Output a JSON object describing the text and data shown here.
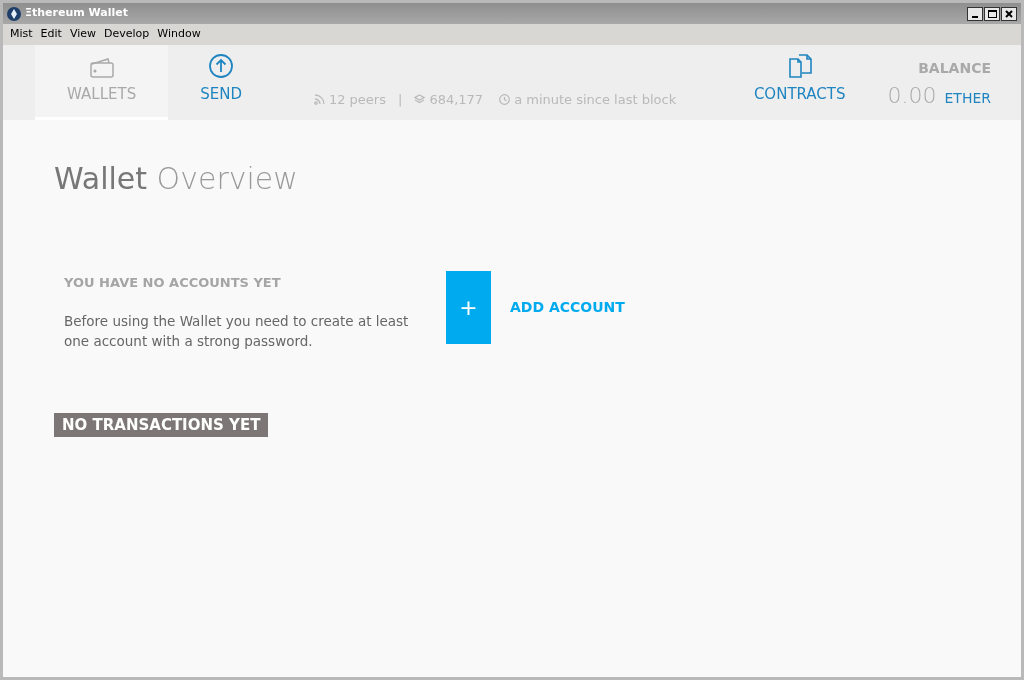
{
  "window": {
    "title": "Ξthereum Wallet"
  },
  "menu": [
    "Mist",
    "Edit",
    "View",
    "Develop",
    "Window"
  ],
  "nav_left": [
    {
      "kind": "wallet",
      "label": "WALLETS",
      "selected": true
    },
    {
      "kind": "send",
      "label": "SEND",
      "selected": false
    }
  ],
  "status": {
    "peers": "12 peers",
    "separator": "|",
    "block": "684,177",
    "last_block": "a minute since last block"
  },
  "nav_right": [
    {
      "kind": "contracts",
      "label": "CONTRACTS",
      "selected": false
    }
  ],
  "balance": {
    "label": "BALANCE",
    "amount": "0.00",
    "unit": "ETHER"
  },
  "page_title": {
    "strong": "Wallet",
    "light": "Overview"
  },
  "accounts": {
    "heading": "YOU HAVE NO ACCOUNTS YET",
    "text": "Before using the Wallet you need to create at least one account with a strong password.",
    "add_symbol": "+",
    "add_label": "ADD ACCOUNT"
  },
  "transactions": {
    "label": "NO TRANSACTIONS YET"
  }
}
